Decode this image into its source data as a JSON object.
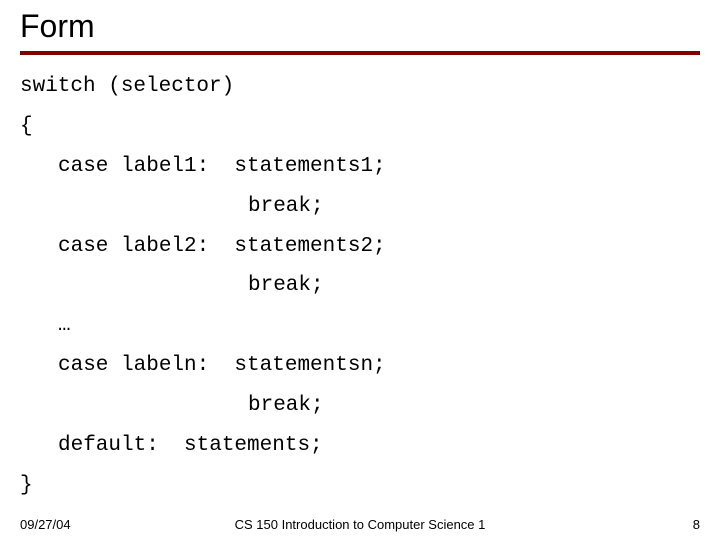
{
  "slide": {
    "title": "Form",
    "code": {
      "line1": "switch (selector)",
      "line2": "{",
      "line3": "case label1:  statements1;",
      "line4": "break;",
      "line5": "case label2:  statements2;",
      "line6": "break;",
      "line7": "…",
      "line8": "case labeln:  statementsn;",
      "line9": "break;",
      "line10": "default:  statements;",
      "line11": "}"
    },
    "footer": {
      "date": "09/27/04",
      "course": "CS 150 Introduction to Computer Science 1",
      "page": "8"
    }
  }
}
